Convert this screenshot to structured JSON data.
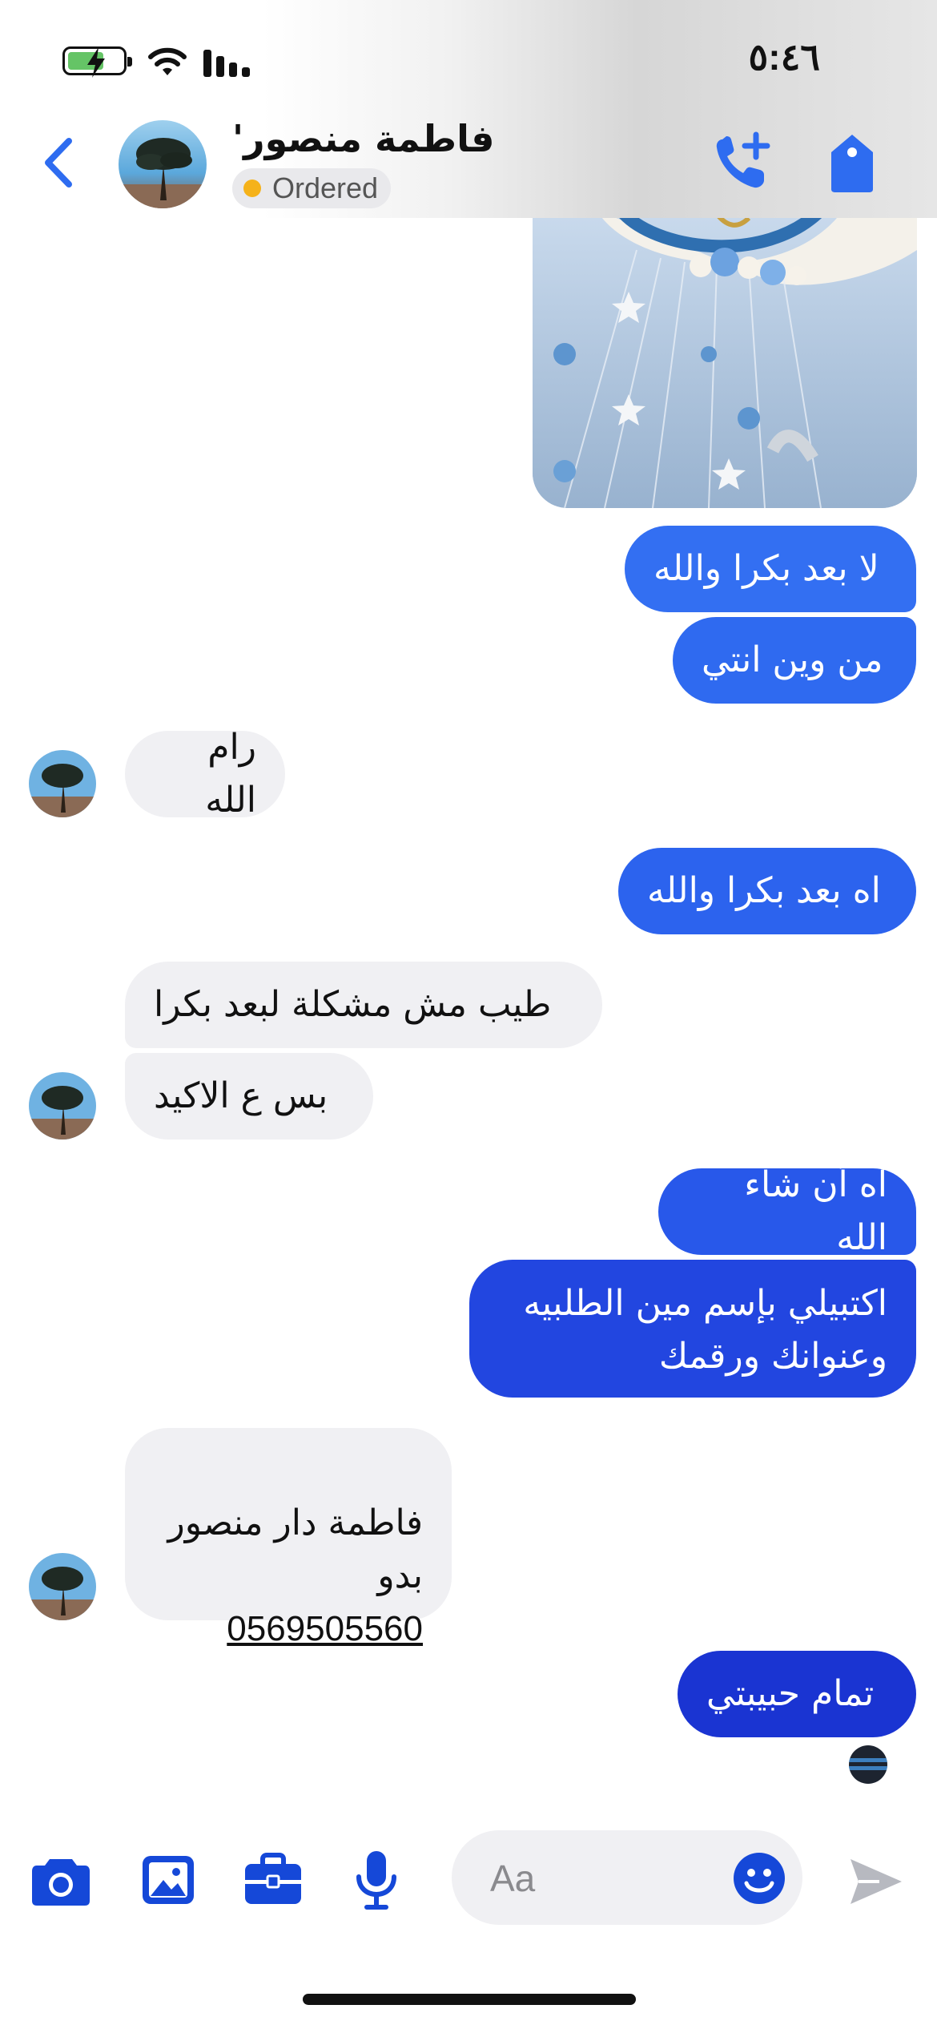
{
  "status": {
    "time": "٥:٤٦"
  },
  "header": {
    "contact_name": "فاطمة منصور'",
    "order_label": "Ordered"
  },
  "messages": [
    {
      "dir": "out",
      "text": "لا بعد بكرا والله"
    },
    {
      "dir": "out",
      "text": "من وين انتي"
    },
    {
      "dir": "in",
      "text": "رام الله"
    },
    {
      "dir": "out",
      "text": "اه بعد بكرا والله"
    },
    {
      "dir": "in",
      "text": "طيب مش مشكلة لبعد بكرا"
    },
    {
      "dir": "in",
      "text": "بس ع الاكيد"
    },
    {
      "dir": "out",
      "text": "اه أن شاء الله"
    },
    {
      "dir": "out",
      "text": "اكتبيلي بإسم مين الطلبيه\nوعنوانك ورقمك"
    },
    {
      "dir": "in",
      "text": "فاطمة دار منصور\nبدو",
      "phone": "0569505560"
    },
    {
      "dir": "out",
      "text": "تمام حبيبتي"
    }
  ],
  "composer": {
    "placeholder": "Aa",
    "icons": [
      "camera-icon",
      "image-icon",
      "briefcase-icon",
      "microphone-icon",
      "emoji-icon",
      "send-icon"
    ]
  },
  "colors": {
    "accent": "#2e6cf0",
    "bubble_out_top": "#3a7bf5",
    "bubble_out_bottom": "#1833d0",
    "bubble_in": "#f0f0f3",
    "badge_dot": "#f5b21a"
  }
}
